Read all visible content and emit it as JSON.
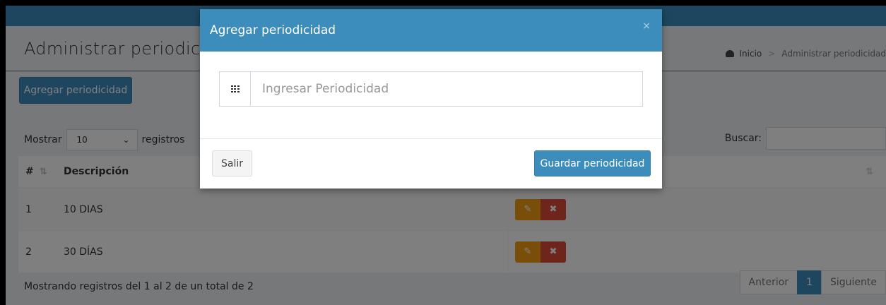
{
  "page": {
    "title": "Administrar periodicidad",
    "breadcrumb": {
      "home": "Inicio",
      "sep": ">",
      "current": "Administrar periodicidad"
    }
  },
  "toolbar": {
    "add_label": "Agregar periodicidad"
  },
  "table_controls": {
    "show_label": "Mostrar",
    "page_size": "10",
    "records_label": "registros",
    "search_label": "Buscar:"
  },
  "table": {
    "columns": [
      "#",
      "Descripción",
      ""
    ],
    "rows": [
      {
        "num": "1",
        "desc": "10 DIAS"
      },
      {
        "num": "2",
        "desc": "30 DÍAS"
      }
    ]
  },
  "footer": {
    "info": "Mostrando registros del 1 al 2 de un total de 2",
    "prev": "Anterior",
    "page": "1",
    "next": "Siguiente"
  },
  "modal": {
    "title": "Agregar periodicidad",
    "close": "×",
    "input_placeholder": "Ingresar Periodicidad",
    "input_value": "",
    "cancel_label": "Salir",
    "save_label": "Guardar periodicidad"
  },
  "colors": {
    "primary": "#3c8dbc",
    "warning": "#f39c12",
    "danger": "#dd4b39"
  },
  "icons": {
    "breadcrumb": "dashboard-icon",
    "input_addon": "th-icon",
    "edit": "pencil-icon",
    "delete": "times-icon"
  }
}
